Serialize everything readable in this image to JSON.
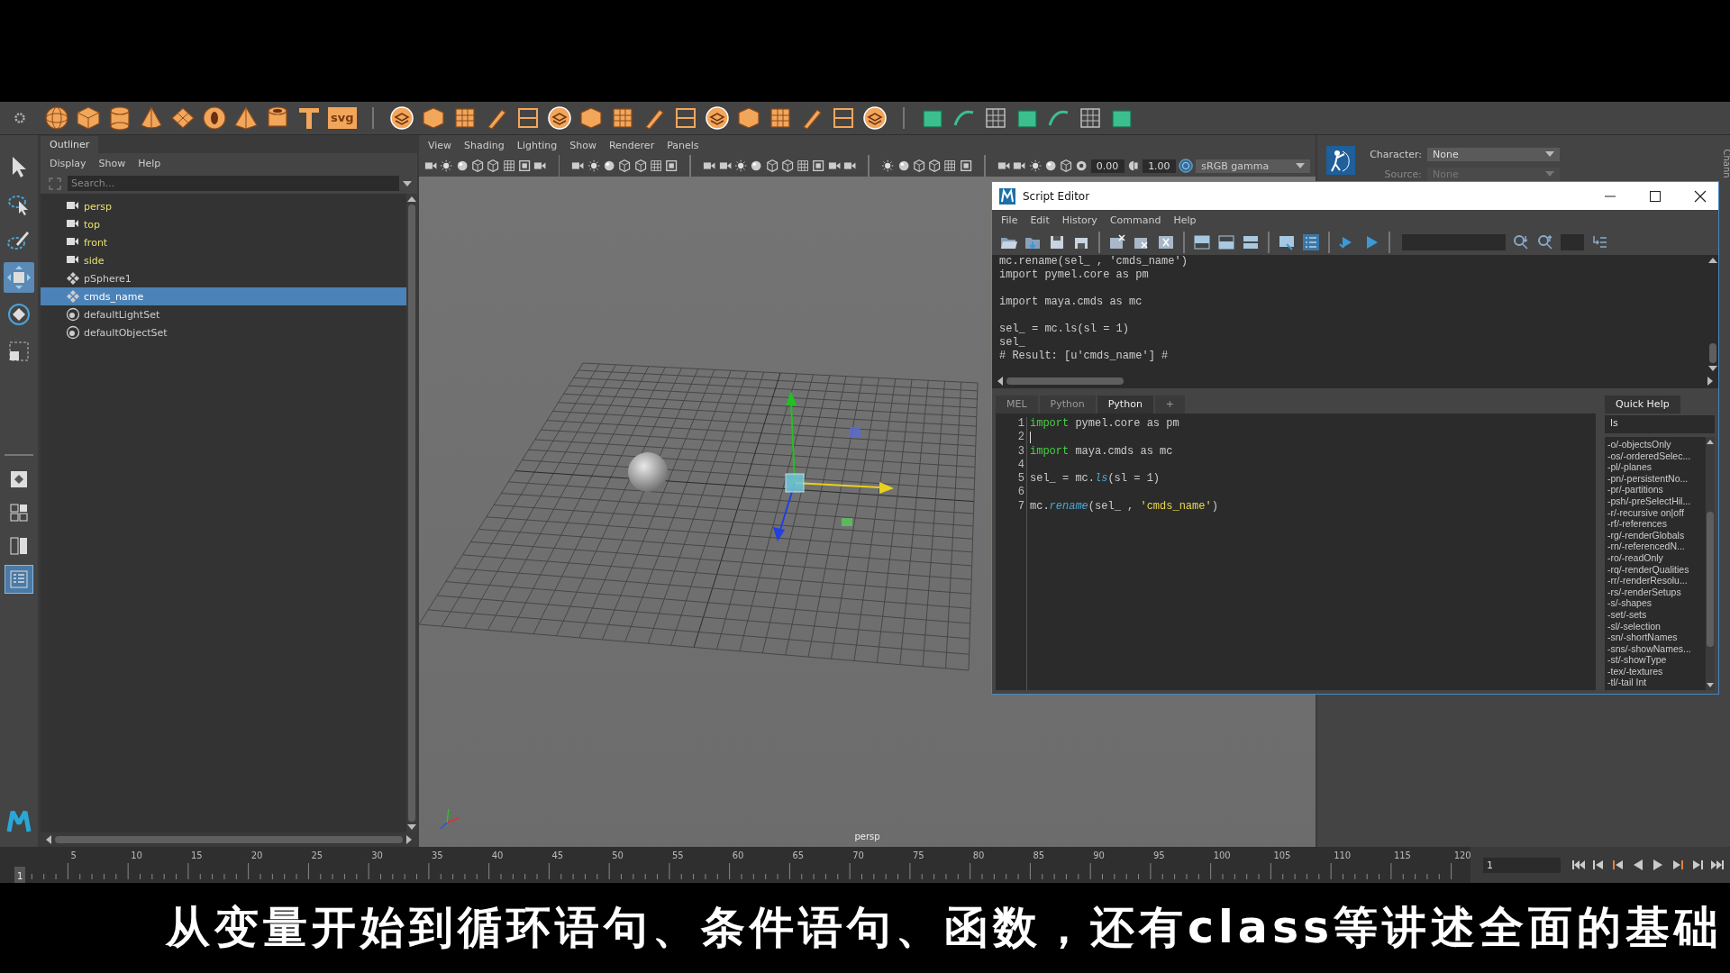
{
  "shelf": {
    "svg_label": "svg"
  },
  "toolbox": [
    {
      "kind": "select",
      "selected": false
    },
    {
      "kind": "lasso",
      "selected": false
    },
    {
      "kind": "paint",
      "selected": false
    },
    {
      "kind": "move",
      "selected": true
    },
    {
      "kind": "rotate",
      "selected": false
    },
    {
      "kind": "scale",
      "selected": false
    }
  ],
  "layout_buttons": [
    {
      "kind": "single",
      "selected": false
    },
    {
      "kind": "four",
      "selected": false
    },
    {
      "kind": "split",
      "selected": false
    },
    {
      "kind": "outliner",
      "selected": true
    }
  ],
  "outliner": {
    "title": "Outliner",
    "menu": [
      "Display",
      "Show",
      "Help"
    ],
    "search": {
      "placeholder": "Search..."
    },
    "items": [
      {
        "label": "persp",
        "kind": "camera",
        "selected": false
      },
      {
        "label": "top",
        "kind": "camera",
        "selected": false
      },
      {
        "label": "front",
        "kind": "camera",
        "selected": false
      },
      {
        "label": "side",
        "kind": "camera",
        "selected": false
      },
      {
        "label": "pSphere1",
        "kind": "transform",
        "selected": false
      },
      {
        "label": "cmds_name",
        "kind": "transform",
        "selected": true
      },
      {
        "label": "defaultLightSet",
        "kind": "set",
        "selected": false
      },
      {
        "label": "defaultObjectSet",
        "kind": "set",
        "selected": false
      }
    ]
  },
  "viewport": {
    "menu": [
      "View",
      "Shading",
      "Lighting",
      "Show",
      "Renderer",
      "Panels"
    ],
    "exposure": "0.00",
    "gamma": "1.00",
    "color_space": "sRGB gamma",
    "camera_label": "persp"
  },
  "character_panel": {
    "character_label": "Character:",
    "character": "None",
    "source_label": "Source:",
    "source": "None",
    "source_disabled": true,
    "side_tab": "Chann"
  },
  "script_editor": {
    "title": "Script Editor",
    "menu": [
      "File",
      "Edit",
      "History",
      "Command",
      "Help"
    ],
    "history": [
      {
        "kind": "text",
        "text": "mc.rename(sel_ , 'cmds_name')"
      },
      {
        "kind": "text",
        "text": "import pymel.core as pm"
      },
      {
        "kind": "blank"
      },
      {
        "kind": "text",
        "text": "import maya.cmds as mc"
      },
      {
        "kind": "blank"
      },
      {
        "kind": "text",
        "text": "sel_ = mc.ls(sl = 1)"
      },
      {
        "kind": "text",
        "text": "sel_"
      },
      {
        "kind": "text",
        "text": "# Result: [u'cmds_name'] #"
      }
    ],
    "tabs": [
      {
        "label": "MEL",
        "selected": false
      },
      {
        "label": "Python",
        "selected": false
      },
      {
        "label": "Python",
        "selected": true
      },
      {
        "label": "+",
        "selected": false
      }
    ],
    "code": [
      {
        "number": "1",
        "cursor": false,
        "tokens": [
          {
            "text": "import",
            "kind": "keyword"
          },
          {
            "text": " pymel.core as pm",
            "kind": "plain"
          }
        ]
      },
      {
        "number": "2",
        "cursor": true
      },
      {
        "number": "3",
        "cursor": false,
        "tokens": [
          {
            "text": "import",
            "kind": "keyword"
          },
          {
            "text": " maya.cmds as mc",
            "kind": "plain"
          }
        ]
      },
      {
        "number": "4",
        "cursor": false
      },
      {
        "number": "5",
        "cursor": false,
        "tokens": [
          {
            "text": "sel_ = mc.",
            "kind": "plain"
          },
          {
            "text": "ls",
            "kind": "function"
          },
          {
            "text": "(sl = 1)",
            "kind": "plain"
          }
        ]
      },
      {
        "number": "6",
        "cursor": false
      },
      {
        "number": "7",
        "cursor": false,
        "tokens": [
          {
            "text": "mc.",
            "kind": "plain"
          },
          {
            "text": "rename",
            "kind": "function"
          },
          {
            "text": "(sel_ , ",
            "kind": "plain"
          },
          {
            "text": "'cmds_name'",
            "kind": "string"
          },
          {
            "text": ")",
            "kind": "plain"
          }
        ]
      }
    ],
    "quick_help": {
      "title": "Quick Help",
      "query": "ls",
      "flags": [
        "-o/-objectsOnly",
        "-os/-orderedSelec...",
        "-pl/-planes",
        "-pn/-persistentNo...",
        "-pr/-partitions",
        "-psh/-preSelectHil...",
        "-r/-recursive on|off",
        "-rf/-references",
        "-rg/-renderGlobals",
        "-rn/-referencedN...",
        "-ro/-readOnly",
        "-rq/-renderQualities",
        "-rr/-renderResolu...",
        "-rs/-renderSetups",
        "-s/-shapes",
        "-set/-sets",
        "-sl/-selection",
        "-sn/-shortNames",
        "-sns/-showNames...",
        "-st/-showType",
        "-tex/-textures",
        "-tl/-tail Int"
      ]
    }
  },
  "timeline": {
    "ticks": [
      "5",
      "10",
      "15",
      "20",
      "25",
      "30",
      "35",
      "40",
      "45",
      "50",
      "55",
      "60",
      "65",
      "70",
      "75",
      "80",
      "85",
      "90",
      "95",
      "100",
      "105",
      "110",
      "115",
      "120"
    ],
    "current_frame": "1",
    "frame_field": "1"
  },
  "subtitle": "从变量开始到循环语句、条件语句、函数，还有class等讲述全面的基础"
}
